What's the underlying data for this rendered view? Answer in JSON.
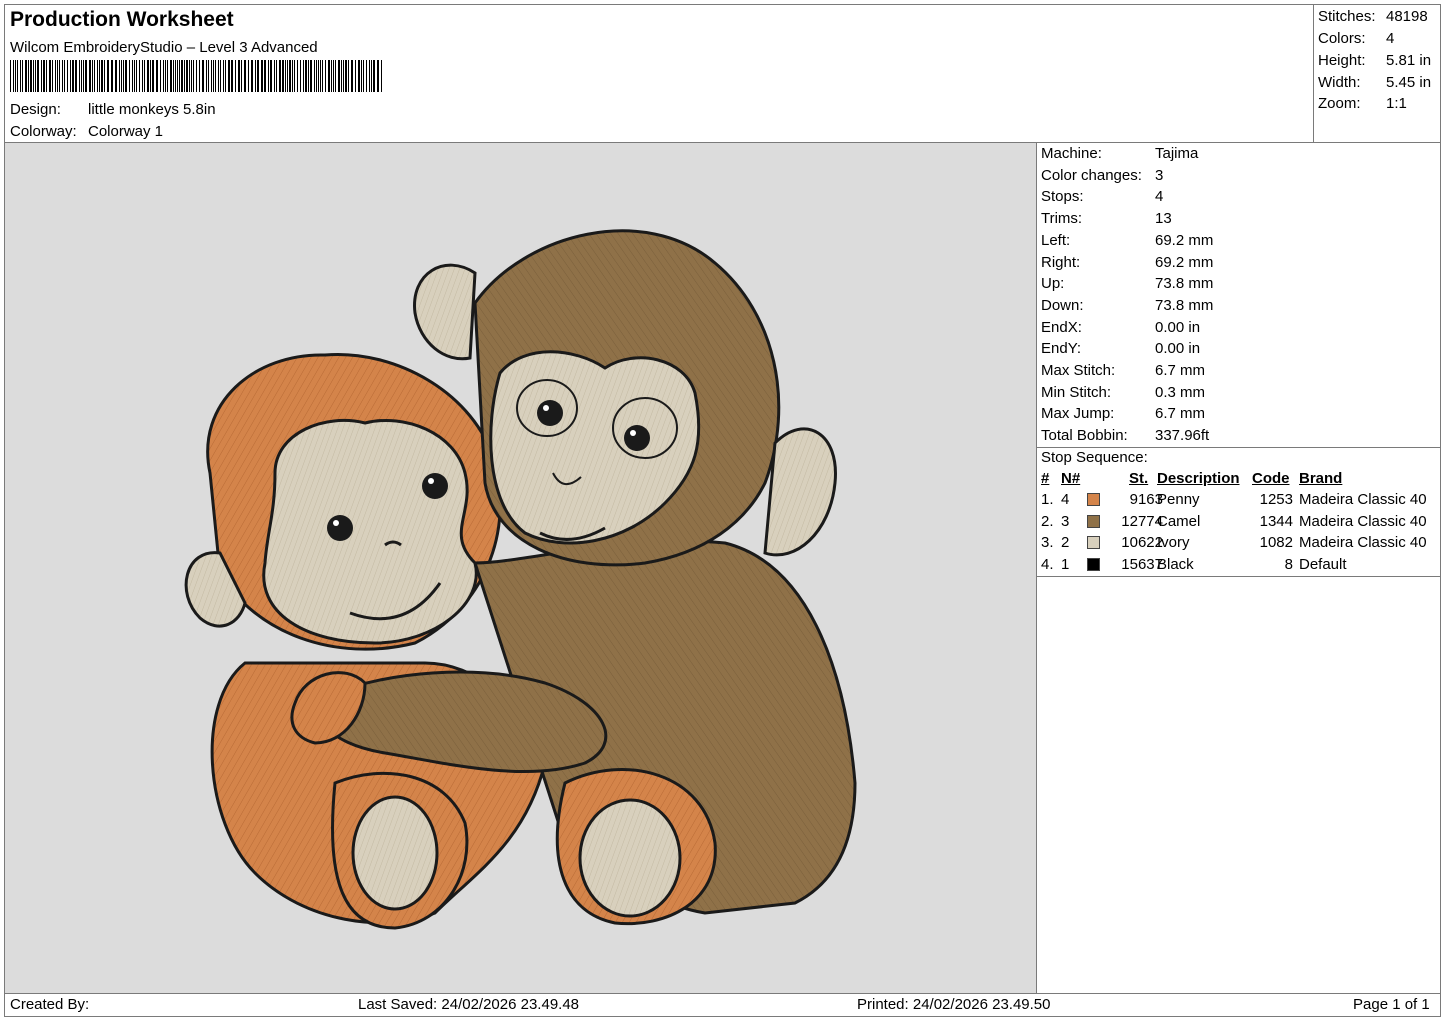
{
  "header": {
    "title": "Production Worksheet",
    "software": "Wilcom EmbroideryStudio – Level 3 Advanced",
    "design_label": "Design:",
    "design_value": "little monkeys 5.8in",
    "colorway_label": "Colorway:",
    "colorway_value": "Colorway 1"
  },
  "stats": [
    {
      "label": "Stitches:",
      "value": "48198"
    },
    {
      "label": "Colors:",
      "value": "4"
    },
    {
      "label": "Height:",
      "value": "5.81 in"
    },
    {
      "label": "Width:",
      "value": "5.45 in"
    },
    {
      "label": "Zoom:",
      "value": "1:1"
    }
  ],
  "machine_info": [
    {
      "label": "Machine:",
      "value": "Tajima"
    },
    {
      "label": "Color changes:",
      "value": "3"
    },
    {
      "label": "Stops:",
      "value": "4"
    },
    {
      "label": "Trims:",
      "value": "13"
    },
    {
      "label": "Left:",
      "value": "69.2 mm"
    },
    {
      "label": "Right:",
      "value": "69.2 mm"
    },
    {
      "label": "Up:",
      "value": "73.8 mm"
    },
    {
      "label": "Down:",
      "value": "73.8 mm"
    },
    {
      "label": "EndX:",
      "value": "0.00 in"
    },
    {
      "label": "EndY:",
      "value": "0.00 in"
    },
    {
      "label": "Max Stitch:",
      "value": "6.7 mm"
    },
    {
      "label": "Min Stitch:",
      "value": "0.3 mm"
    },
    {
      "label": "Max Jump:",
      "value": "6.7 mm"
    },
    {
      "label": "Total Bobbin:",
      "value": "337.96ft"
    }
  ],
  "stop_sequence": {
    "title": "Stop Sequence:",
    "columns": [
      "#",
      "N#",
      "St.",
      "Description",
      "Code",
      "Brand"
    ],
    "rows": [
      {
        "idx": "1.",
        "n": "4",
        "st": "9163",
        "desc": "Penny",
        "code": "1253",
        "brand": "Madeira Classic 40",
        "color": "#d4844a"
      },
      {
        "idx": "2.",
        "n": "3",
        "st": "12774",
        "desc": "Camel",
        "code": "1344",
        "brand": "Madeira Classic 40",
        "color": "#8f7148"
      },
      {
        "idx": "3.",
        "n": "2",
        "st": "10622",
        "desc": "Ivory",
        "code": "1082",
        "brand": "Madeira Classic 40",
        "color": "#d8d0bd"
      },
      {
        "idx": "4.",
        "n": "1",
        "st": "15637",
        "desc": "Black",
        "code": "8",
        "brand": "Default",
        "color": "#000000"
      }
    ]
  },
  "footer": {
    "created_by": "Created By:",
    "last_saved": "Last Saved: 24/02/2026 23.49.48",
    "printed": "Printed: 24/02/2026 23.49.50",
    "page": "Page 1 of 1"
  },
  "colors": {
    "canvas_bg": "#dcdcdc",
    "penny": "#d4844a",
    "camel": "#8f7148",
    "ivory": "#d8d0bd",
    "outline": "#1a1a1a"
  }
}
